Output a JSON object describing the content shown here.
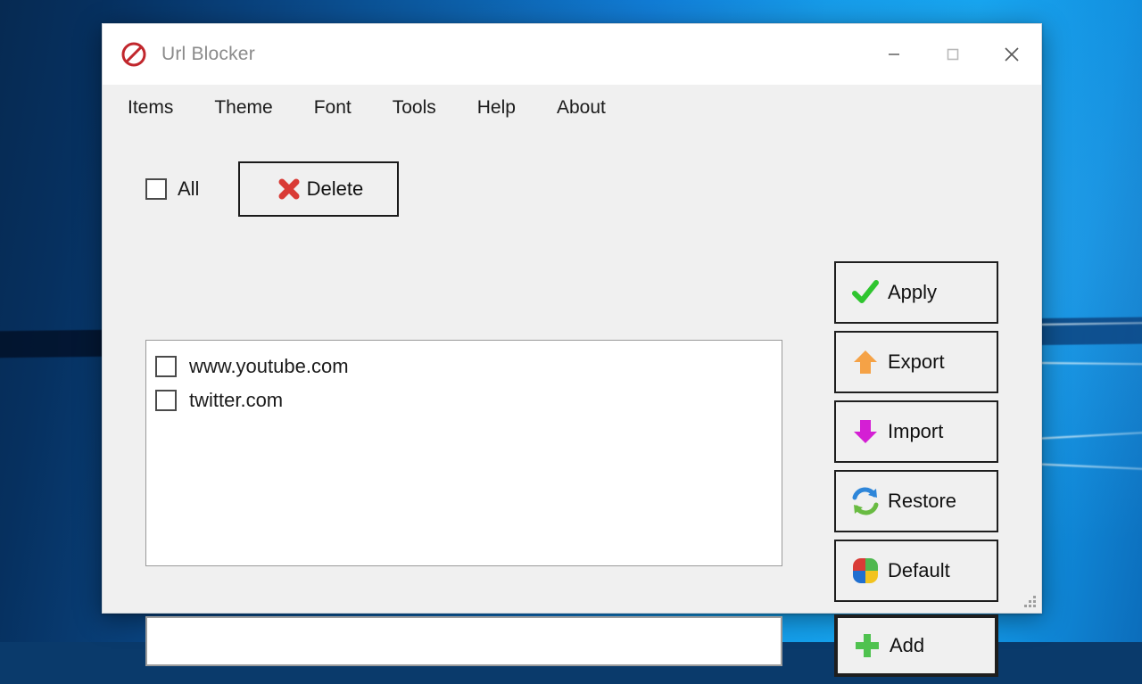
{
  "window": {
    "title": "Url Blocker",
    "app_icon": "prohibition-icon",
    "controls": {
      "minimize": "minimize-icon",
      "maximize": "maximize-icon",
      "close": "close-icon"
    }
  },
  "menubar": {
    "items": [
      {
        "label": "Items"
      },
      {
        "label": "Theme"
      },
      {
        "label": "Font"
      },
      {
        "label": "Tools"
      },
      {
        "label": "Help"
      },
      {
        "label": "About"
      }
    ]
  },
  "toolbar": {
    "select_all_label": "All",
    "select_all_checked": false,
    "delete_label": "Delete",
    "delete_icon": "red-x-icon"
  },
  "list": {
    "items": [
      {
        "label": "www.youtube.com",
        "checked": false
      },
      {
        "label": "twitter.com",
        "checked": false
      }
    ]
  },
  "input": {
    "value": "",
    "placeholder": ""
  },
  "side_buttons": [
    {
      "label": "Apply",
      "icon": "green-check-icon"
    },
    {
      "label": "Export",
      "icon": "orange-up-arrow-icon"
    },
    {
      "label": "Import",
      "icon": "magenta-down-arrow-icon"
    },
    {
      "label": "Restore",
      "icon": "refresh-arrows-icon"
    },
    {
      "label": "Default",
      "icon": "four-color-squares-icon"
    },
    {
      "label": "Add",
      "icon": "green-plus-icon"
    }
  ],
  "colors": {
    "window_body": "#f0f0f0",
    "titlebar": "#ffffff",
    "title_text": "#8a8a8a",
    "accent_delete": "#d93b36",
    "accent_apply": "#2fc52f",
    "accent_export": "#f5a246",
    "accent_import": "#d41fd4",
    "accent_restore_blue": "#2e86d9",
    "accent_restore_green": "#69bb42",
    "accent_add": "#4fc24f",
    "desktop_blue": "#0f7ad4"
  }
}
